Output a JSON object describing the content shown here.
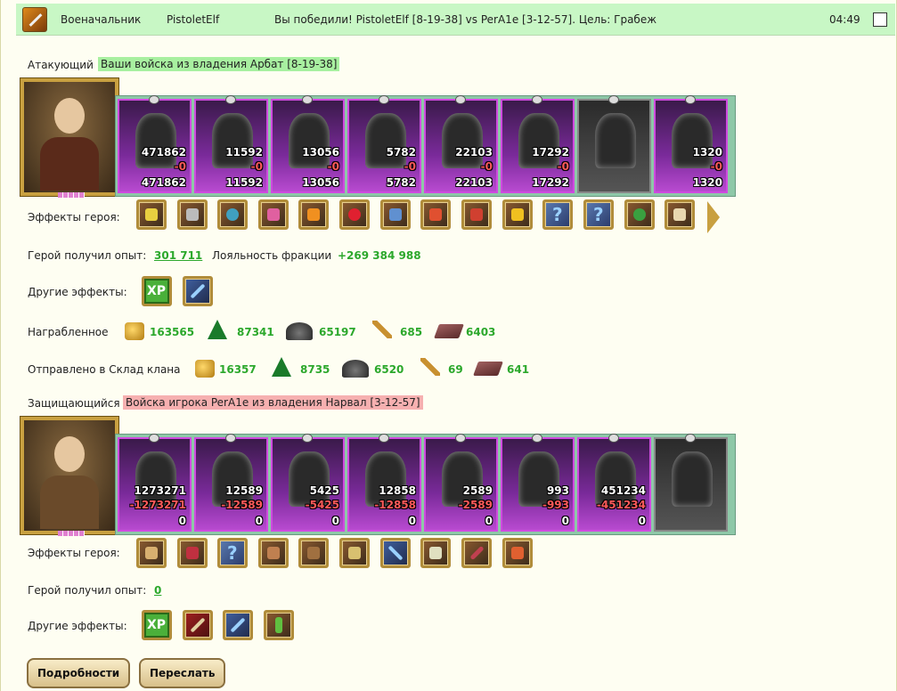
{
  "header": {
    "role": "Военачальник",
    "player": "PistoletElf",
    "message": "Вы победили! PistoletElf [8-19-38] vs PerA1e [3-12-57]. Цель: Грабеж",
    "time": "04:49"
  },
  "attacker": {
    "label": "Атакующий",
    "army_desc": "Ваши войска из владения Арбат [8-19-38]",
    "units": [
      {
        "n1": "471862",
        "n2": "-0",
        "n3": "471862"
      },
      {
        "n1": "11592",
        "n2": "-0",
        "n3": "11592"
      },
      {
        "n1": "13056",
        "n2": "-0",
        "n3": "13056"
      },
      {
        "n1": "5782",
        "n2": "-0",
        "n3": "5782"
      },
      {
        "n1": "22103",
        "n2": "-0",
        "n3": "22103"
      },
      {
        "n1": "17292",
        "n2": "-0",
        "n3": "17292"
      },
      {
        "n1": "",
        "n2": "",
        "n3": ""
      },
      {
        "n1": "1320",
        "n2": "-0",
        "n3": "1320"
      }
    ],
    "effects_label": "Эффекты героя:",
    "exp_label": "Герой получил опыт:",
    "exp_value": "301 711",
    "loyalty_label": "Лояльность фракции",
    "loyalty_value": "+269 384 988",
    "other_effects_label": "Другие эффекты:",
    "loot_label": "Награбленное",
    "loot": [
      "163565",
      "87341",
      "65197",
      "685",
      "6403"
    ],
    "clan_label": "Отправлено в Склад клана",
    "clan": [
      "16357",
      "8735",
      "6520",
      "69",
      "641"
    ]
  },
  "defender": {
    "label": "Защищающийся",
    "army_desc": "Войска игрока PerA1e из владения Нарвал [3-12-57]",
    "units": [
      {
        "n1": "1273271",
        "n2": "-1273271",
        "n3": "0"
      },
      {
        "n1": "12589",
        "n2": "-12589",
        "n3": "0"
      },
      {
        "n1": "5425",
        "n2": "-5425",
        "n3": "0"
      },
      {
        "n1": "12858",
        "n2": "-12858",
        "n3": "0"
      },
      {
        "n1": "2589",
        "n2": "-2589",
        "n3": "0"
      },
      {
        "n1": "993",
        "n2": "-993",
        "n3": "0"
      },
      {
        "n1": "451234",
        "n2": "-451234",
        "n3": "0"
      },
      {
        "n1": "",
        "n2": "",
        "n3": ""
      }
    ],
    "effects_label": "Эффекты героя:",
    "exp_label": "Герой получил опыт:",
    "exp_value": "0",
    "other_effects_label": "Другие эффекты:"
  },
  "buttons": {
    "details": "Подробности",
    "forward": "Переслать"
  },
  "icons": {
    "xp": "XP"
  }
}
